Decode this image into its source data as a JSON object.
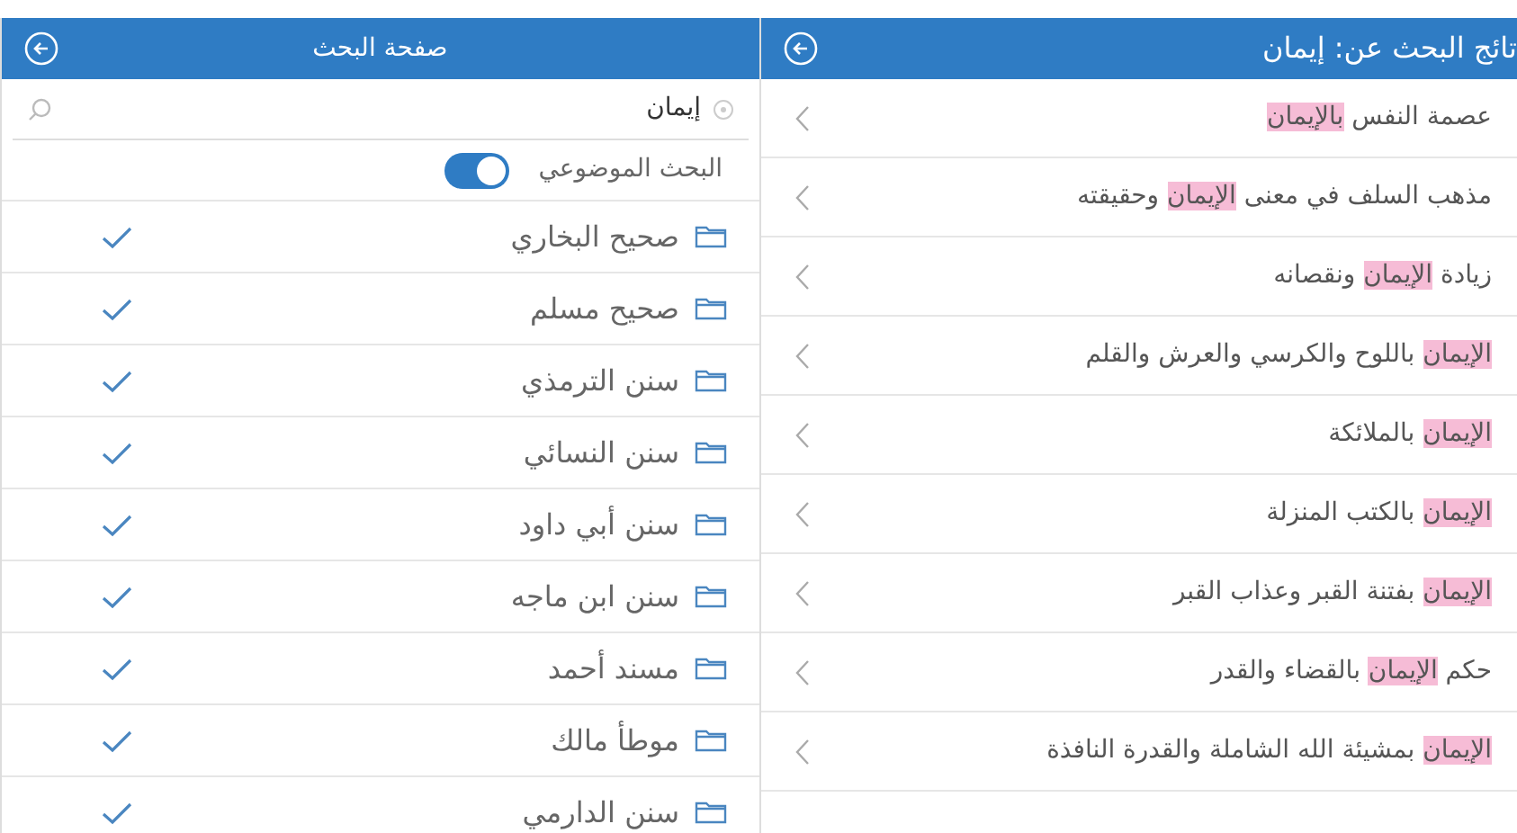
{
  "search_page": {
    "title": "صفحة البحث",
    "search": {
      "value": "إيمان"
    },
    "topic_search": {
      "label": "البحث الموضوعي",
      "on": true
    },
    "books": [
      {
        "name": "صحيح البخاري",
        "checked": true
      },
      {
        "name": "صحيح مسلم",
        "checked": true
      },
      {
        "name": "سنن الترمذي",
        "checked": true
      },
      {
        "name": "سنن النسائي",
        "checked": true
      },
      {
        "name": "سنن أبي داود",
        "checked": true
      },
      {
        "name": "سنن ابن ماجه",
        "checked": true
      },
      {
        "name": "مسند أحمد",
        "checked": true
      },
      {
        "name": "موطأ مالك",
        "checked": true
      },
      {
        "name": "سنن الدارمي",
        "checked": true
      }
    ]
  },
  "results_page": {
    "title": "تائج البحث عن: إيمان",
    "results": [
      "عصمة النفس **بالإيمان**",
      "مذهب السلف في معنى **الإيمان** وحقيقته",
      "زيادة **الإيمان** ونقصانه",
      "**الإيمان** باللوح والكرسي والعرش والقلم",
      "**الإيمان** بالملائكة",
      "**الإيمان** بالكتب المنزلة",
      "**الإيمان** بفتنة القبر وعذاب القبر",
      "حكم **الإيمان** بالقضاء والقدر",
      "**الإيمان** بمشيئة الله الشاملة والقدرة النافذة"
    ]
  }
}
